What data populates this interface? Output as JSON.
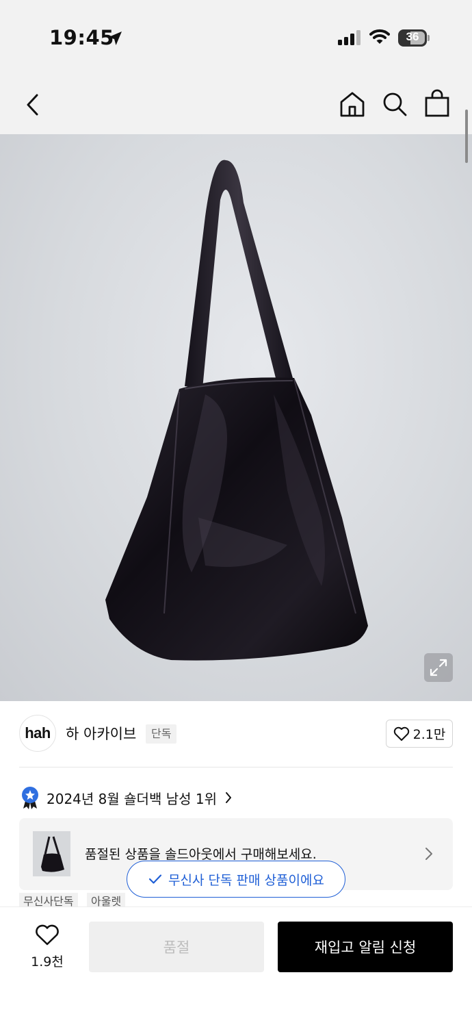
{
  "status_bar": {
    "time": "19:45",
    "battery": "36",
    "icons": [
      "location-arrow-icon",
      "signal-icon",
      "wifi-icon",
      "battery-icon"
    ]
  },
  "nav": {
    "icons": [
      "back-chevron-icon",
      "home-icon",
      "search-icon",
      "shopping-bag-icon"
    ]
  },
  "product": {
    "image_subject": "black glossy shoulder bag",
    "expand_icon": "expand-icon"
  },
  "brand": {
    "logo_text": "hah",
    "name": "하 아카이브",
    "exclusive_tag": "단독",
    "likes": "2.1만"
  },
  "ranking": {
    "text": "2024년 8월 숄더백 남성 1위",
    "badge_color": "#2f6fe0"
  },
  "soldout_card": {
    "text": "품절된 상품을 솔드아웃에서 구매해보세요."
  },
  "toast": {
    "text": "무신사 단독 판매 상품이에요",
    "color": "#1f5fd6"
  },
  "tags": [
    "무신사단독",
    "아울렛"
  ],
  "bottom_bar": {
    "wish_count": "1.9천",
    "soldout_label": "품절",
    "restock_label": "재입고 알림 신청"
  }
}
